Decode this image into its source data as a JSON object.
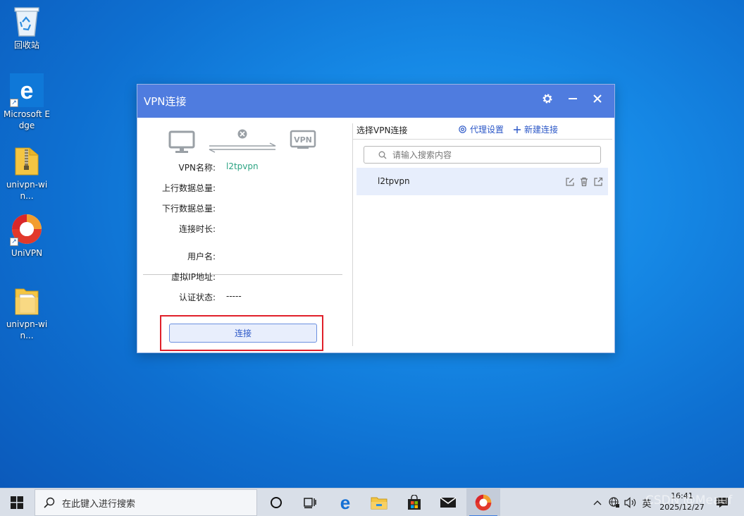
{
  "desktop": {
    "icons": [
      {
        "label": "回收站"
      },
      {
        "label": "Microsoft Edge"
      },
      {
        "label": "univpn-win..."
      },
      {
        "label": "UniVPN"
      },
      {
        "label": "univpn-win..."
      }
    ]
  },
  "window": {
    "title": "VPN连接",
    "status": {
      "vpn_name_label": "VPN名称:",
      "vpn_name_value": "l2tpvpn",
      "upload_label": "上行数据总量:",
      "upload_value": "",
      "download_label": "下行数据总量:",
      "download_value": "",
      "duration_label": "连接时长:",
      "duration_value": "",
      "username_label": "用户名:",
      "username_value": "",
      "virtual_ip_label": "虚拟IP地址:",
      "virtual_ip_value": "",
      "auth_label": "认证状态:",
      "auth_value": "-----"
    },
    "diagram_vpn_text": "VPN",
    "connect_button": "连接",
    "right": {
      "title": "选择VPN连接",
      "proxy_settings": "代理设置",
      "new_connection": "新建连接",
      "search_placeholder": "请输入搜索内容",
      "connections": [
        {
          "name": "l2tpvpn"
        }
      ]
    }
  },
  "taskbar": {
    "search_placeholder": "在此键入进行搜索",
    "ime_label": "英",
    "clock_time": "16:41",
    "clock_date": "2025/12/27"
  },
  "watermark": "CSDN @Meauf",
  "colors": {
    "titlebar": "#4f7cdf",
    "accent_link": "#2b57c7",
    "vpn_name_value": "#2aa382",
    "highlight_box": "#e0202a",
    "selected_row": "#e7eefc"
  }
}
